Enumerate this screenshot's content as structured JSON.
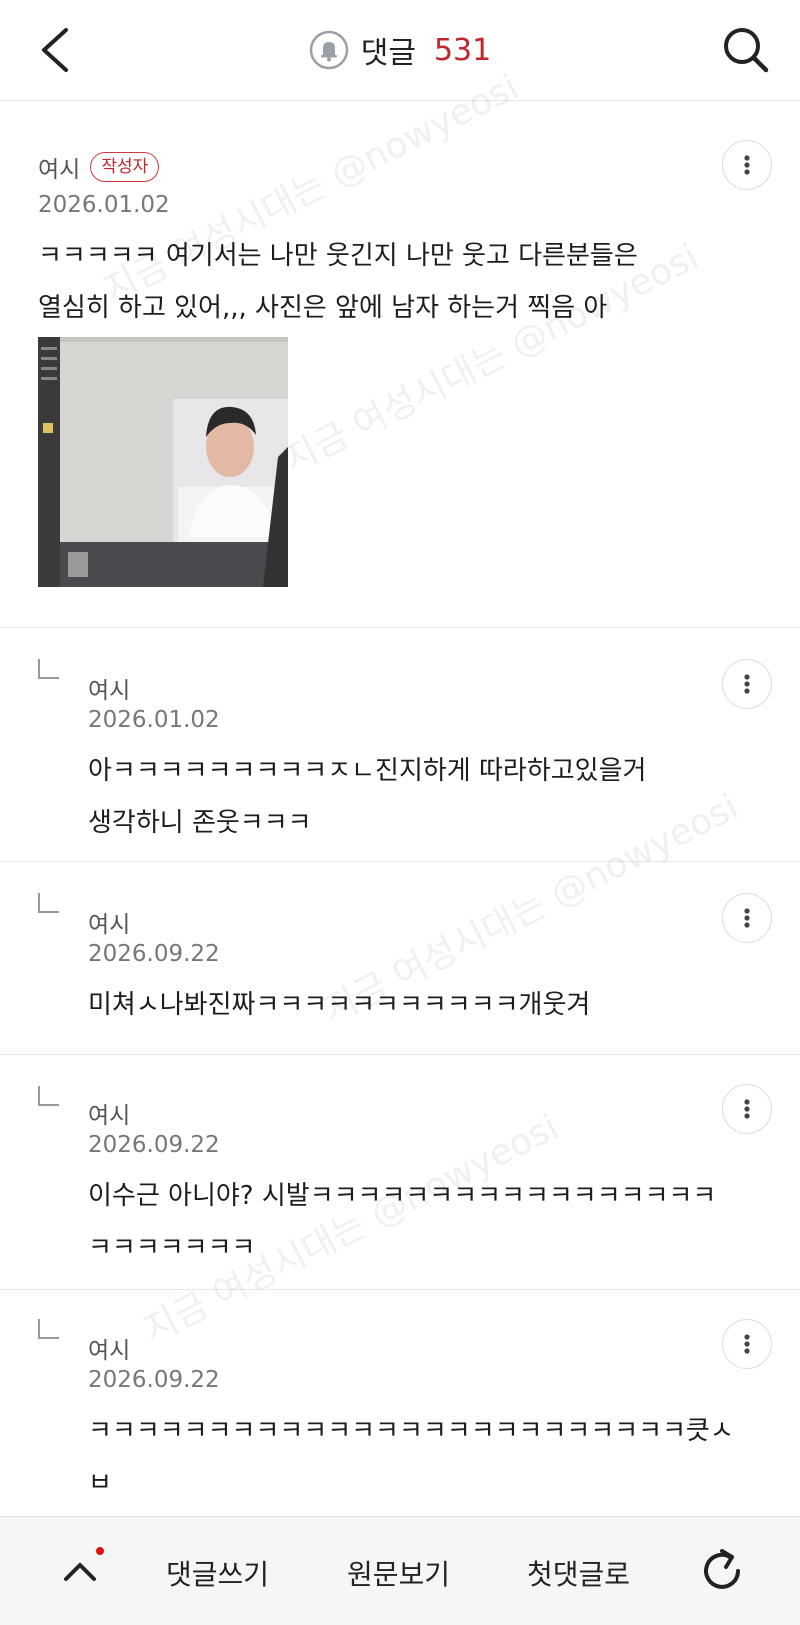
{
  "header": {
    "title": "댓글",
    "comment_count": "531"
  },
  "comments": [
    {
      "author": "여시",
      "badge": "작성자",
      "date": "2026.01.02",
      "text": "ㅋㅋㅋㅋㅋ 여기서는 나만 웃긴지 나만 웃고 다른분들은\n열심히 하고 있어,,, 사진은 앞에 남자 하는거 찍음 아",
      "has_image": true
    },
    {
      "author": "여시",
      "date": "2026.01.02",
      "text": "아ㅋㅋㅋㅋㅋㅋㅋㅋㅋㅈㄴ진지하게 따라하고있을거\n생각하니 존웃ㅋㅋㅋ",
      "is_reply": true
    },
    {
      "author": "여시",
      "date": "2026.09.22",
      "text": "미쳐ㅅ나봐진짜ㅋㅋㅋㅋㅋㅋㅋㅋㅋㅋㅋ개웃겨",
      "is_reply": true
    },
    {
      "author": "여시",
      "date": "2026.09.22",
      "text": "이수근 아니야? 시발ㅋㅋㅋㅋㅋㅋㅋㅋㅋㅋㅋㅋㅋㅋㅋㅋㅋ\nㅋㅋㅋㅋㅋㅋㅋ",
      "is_reply": true
    },
    {
      "author": "여시",
      "date": "2026.09.22",
      "text": "ㅋㅋㅋㅋㅋㅋㅋㅋㅋㅋㅋㅋㅋㅋㅋㅋㅋㅋㅋㅋㅋㅋㅋㅋㅋ큿ㅅ\nㅂ",
      "is_reply": true
    }
  ],
  "bottom_bar": {
    "write_label": "댓글쓰기",
    "original_label": "원문보기",
    "first_label": "첫댓글로"
  },
  "watermarks": [
    "지금 여성시대는 @nowyeosi"
  ],
  "colors": {
    "accent": "#c0262d",
    "divider": "#e8e8e8",
    "bottom_bar_bg": "#f6f6f6"
  },
  "icons": [
    "back-arrow-icon",
    "bell-icon",
    "search-icon",
    "more-vertical-icon",
    "reply-arrow-icon",
    "chevron-up-icon",
    "refresh-icon"
  ]
}
